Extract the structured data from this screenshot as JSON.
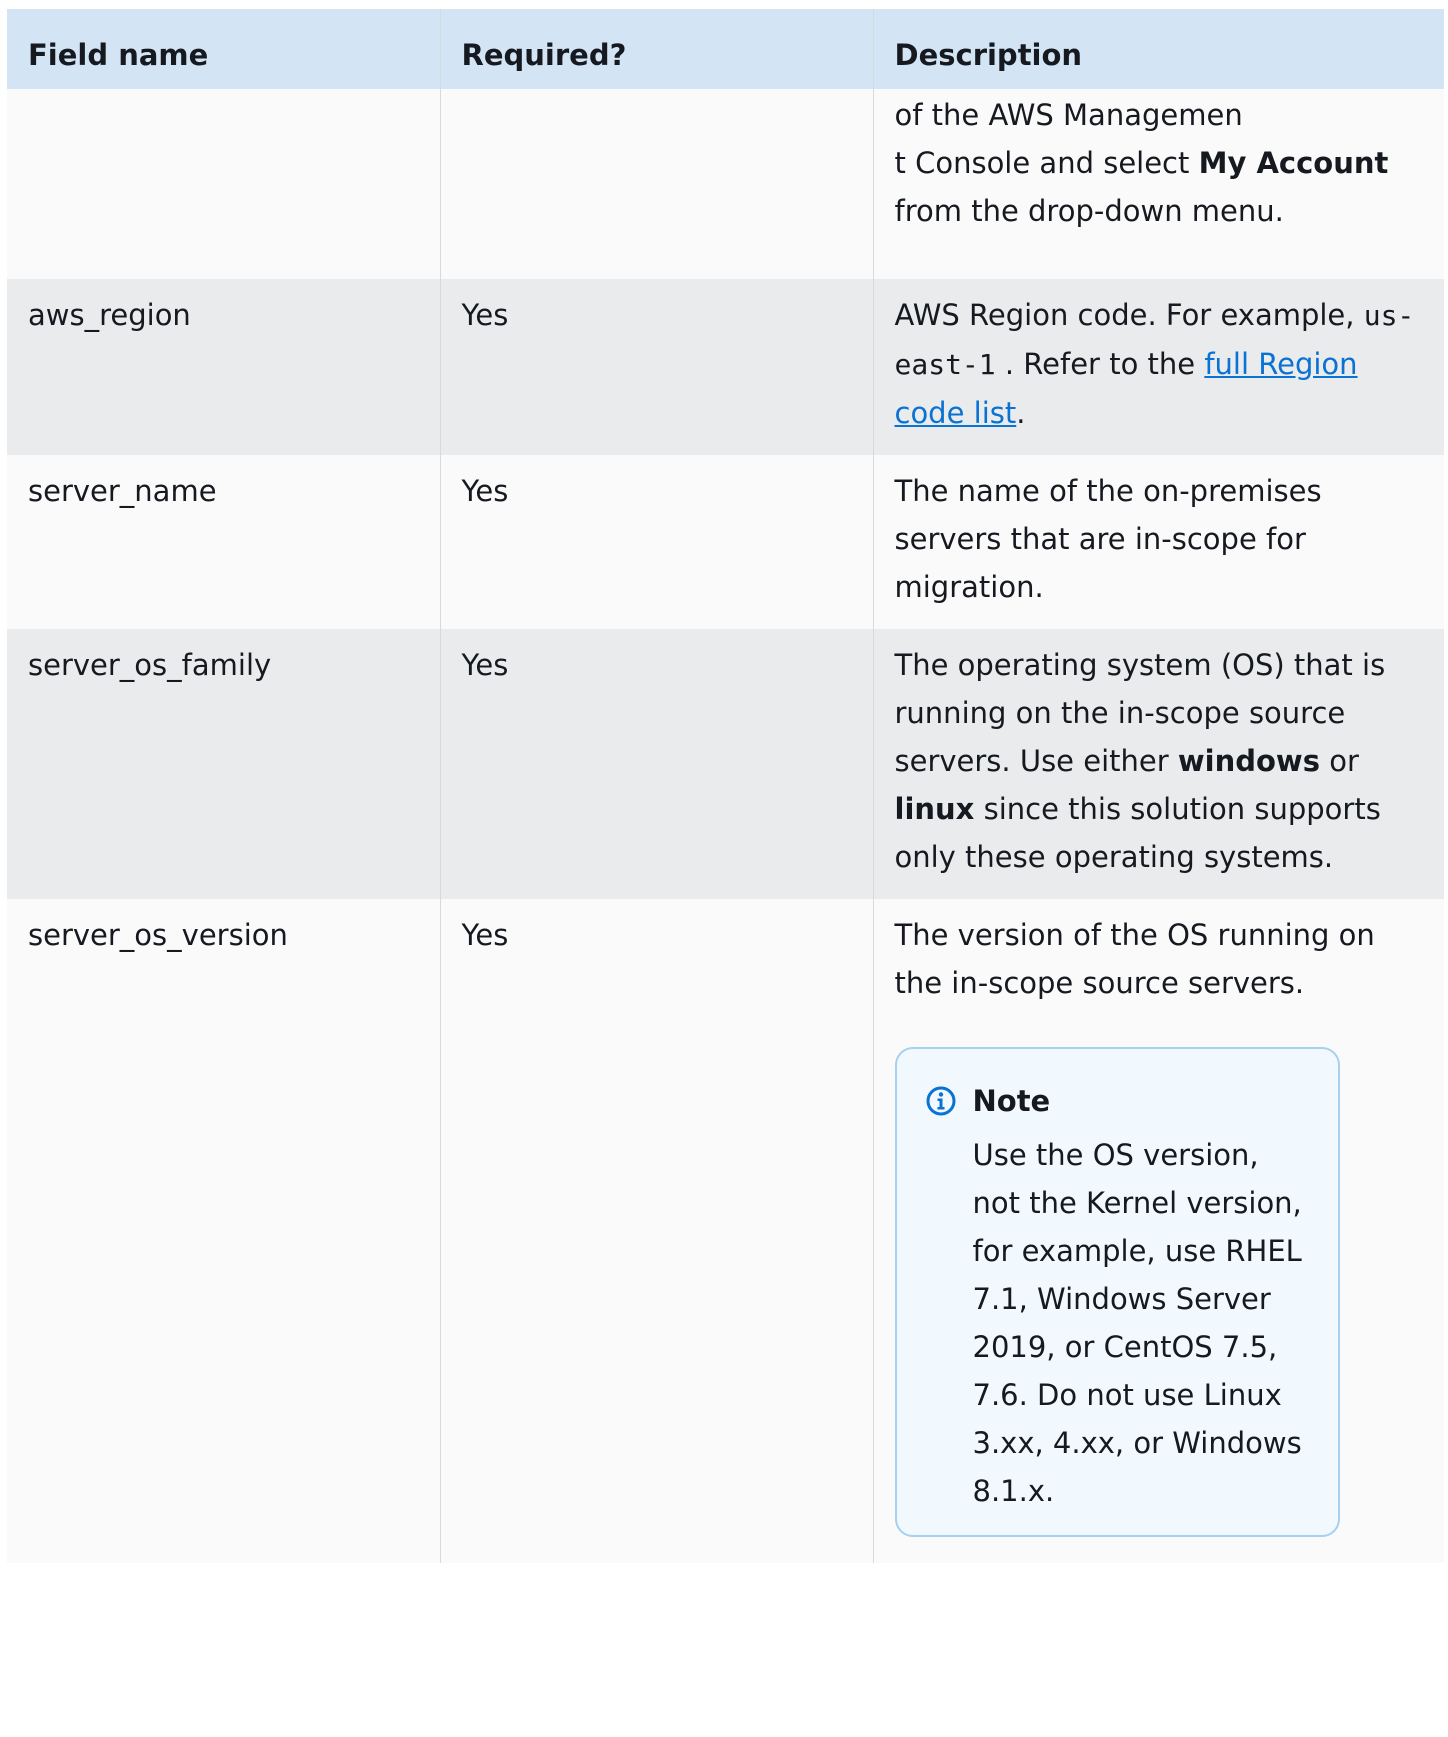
{
  "table": {
    "headers": [
      "Field name",
      "Required?",
      "Description"
    ],
    "continued_description": {
      "part1": "of the AWS Managemen",
      "part2": "t Console and select ",
      "bold1": "My Account",
      "part3": " from the drop-down menu."
    },
    "rows": [
      {
        "field": "aws_region",
        "required": "Yes",
        "desc_before": "AWS Region code. For example, ",
        "desc_code": "us-east-1",
        "desc_mid": " . Refer to the ",
        "desc_link": "full Region code list",
        "desc_after": "."
      },
      {
        "field": "server_name",
        "required": "Yes",
        "desc": "The name of the on-premises servers that are in-scope for migration."
      },
      {
        "field": "server_os_family",
        "required": "Yes",
        "desc_before": "The operating system (OS) that is running on the in-scope source servers. Use either ",
        "bold1": "windows",
        "desc_mid": " or ",
        "bold2": "linux",
        "desc_after": " since this solution supports only these operating systems."
      },
      {
        "field": "server_os_version",
        "required": "Yes",
        "desc": "The version of the OS running on the in-scope source servers.",
        "note_title": "Note",
        "note_body": "Use the OS version, not the Kernel version, for example, use RHEL 7.1, Windows Server 2019, or CentOS 7.5, 7.6. Do not use Linux 3.xx, 4.xx, or Windows 8.1.x."
      }
    ]
  },
  "icons": {
    "note": "info-circle-icon"
  },
  "colors": {
    "header_bg": "#d3e5f5",
    "link": "#0972d3",
    "note_border": "#a7d1f1",
    "note_icon": "#0972d3"
  }
}
